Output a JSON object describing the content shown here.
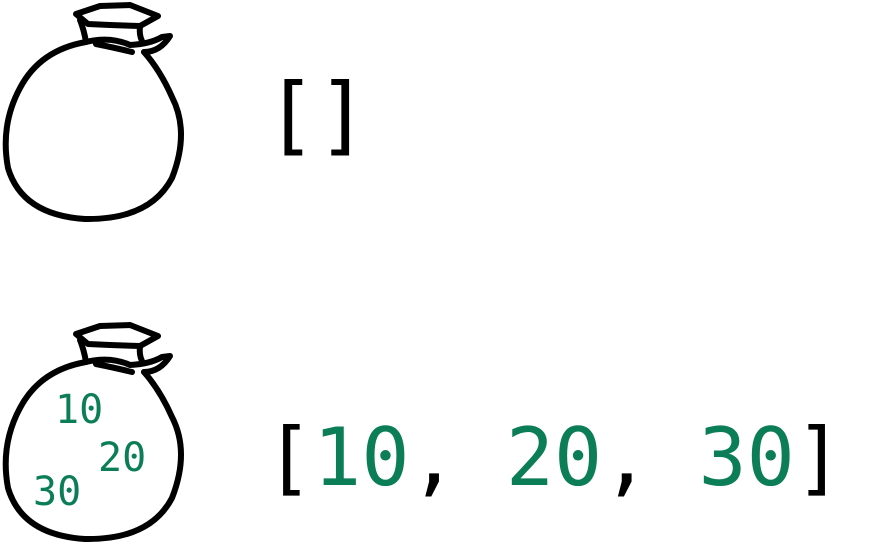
{
  "colors": {
    "outline": "#000000",
    "number": "#0b7d57"
  },
  "icons": {
    "bag": "money-bag-icon"
  },
  "empty_list": {
    "open": "[",
    "close": "]"
  },
  "full_list": {
    "open": "[",
    "close": "]",
    "separator": ", ",
    "items": [
      "10",
      "20",
      "30"
    ]
  },
  "bag_contents": [
    "10",
    "20",
    "30"
  ]
}
